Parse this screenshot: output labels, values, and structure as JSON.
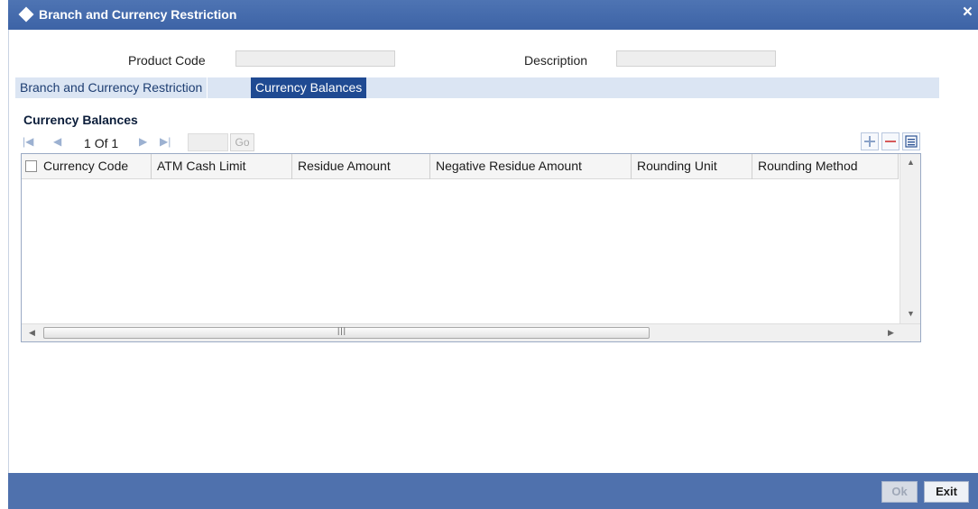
{
  "window": {
    "title": "Branch and Currency Restriction",
    "close_icon": "×"
  },
  "form": {
    "product_code_label": "Product Code",
    "product_code_value": "",
    "description_label": "Description",
    "description_value": ""
  },
  "tabs": [
    {
      "label": "Branch and Currency Restriction",
      "active": false
    },
    {
      "label": "Currency Balances",
      "active": true
    }
  ],
  "section": {
    "title": "Currency Balances"
  },
  "pagination": {
    "current": "1",
    "of_label": "Of",
    "total": "1",
    "go_label": "Go",
    "page_value": ""
  },
  "grid": {
    "columns": [
      "Currency Code",
      "ATM Cash Limit",
      "Residue Amount",
      "Negative Residue Amount",
      "Rounding Unit",
      "Rounding Method"
    ],
    "rows": []
  },
  "footer": {
    "ok_label": "Ok",
    "exit_label": "Exit"
  },
  "colors": {
    "titlebar": "#3d63a6",
    "active_tab": "#1f4a92",
    "tab_strip": "#dbe5f3",
    "footer": "#4f71ad"
  }
}
